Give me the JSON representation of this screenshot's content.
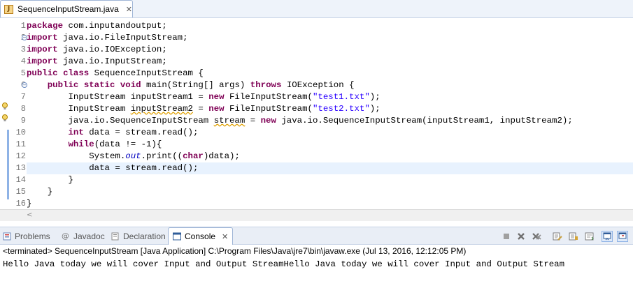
{
  "editor": {
    "tab_title": "SequenceInputStream.java",
    "tab_close": "✕",
    "current_line": 13
  },
  "code_lines": [
    [
      {
        "t": "kw",
        "v": "package"
      },
      {
        "t": "",
        "v": " com.inputandoutput;"
      }
    ],
    [
      {
        "t": "kw",
        "v": "import"
      },
      {
        "t": "",
        "v": " java.io.FileInputStream;"
      }
    ],
    [
      {
        "t": "kw",
        "v": "import"
      },
      {
        "t": "",
        "v": " java.io.IOException;"
      }
    ],
    [
      {
        "t": "kw",
        "v": "import"
      },
      {
        "t": "",
        "v": " java.io.InputStream;"
      }
    ],
    [
      {
        "t": "kw",
        "v": "public"
      },
      {
        "t": "",
        "v": " "
      },
      {
        "t": "kw",
        "v": "class"
      },
      {
        "t": "",
        "v": " SequenceInputStream {"
      }
    ],
    [
      {
        "t": "",
        "v": "    "
      },
      {
        "t": "kw",
        "v": "public"
      },
      {
        "t": "",
        "v": " "
      },
      {
        "t": "kw",
        "v": "static"
      },
      {
        "t": "",
        "v": " "
      },
      {
        "t": "kw",
        "v": "void"
      },
      {
        "t": "",
        "v": " main(String[] args) "
      },
      {
        "t": "kw",
        "v": "throws"
      },
      {
        "t": "",
        "v": " IOException {"
      }
    ],
    [
      {
        "t": "",
        "v": "        InputStream inputStream1 = "
      },
      {
        "t": "kw",
        "v": "new"
      },
      {
        "t": "",
        "v": " FileInputStream("
      },
      {
        "t": "str",
        "v": "\"test1.txt\""
      },
      {
        "t": "",
        "v": ");"
      }
    ],
    [
      {
        "t": "",
        "v": "        InputStream "
      },
      {
        "t": "warn",
        "v": "inputStream2"
      },
      {
        "t": "",
        "v": " = "
      },
      {
        "t": "kw",
        "v": "new"
      },
      {
        "t": "",
        "v": " FileInputStream("
      },
      {
        "t": "str",
        "v": "\"test2.txt\""
      },
      {
        "t": "",
        "v": ");"
      }
    ],
    [
      {
        "t": "",
        "v": "        java.io.SequenceInputStream "
      },
      {
        "t": "warn",
        "v": "stream"
      },
      {
        "t": "",
        "v": " = "
      },
      {
        "t": "kw",
        "v": "new"
      },
      {
        "t": "",
        "v": " java.io.SequenceInputStream(inputStream1, inputStream2);"
      }
    ],
    [
      {
        "t": "",
        "v": "        "
      },
      {
        "t": "kw",
        "v": "int"
      },
      {
        "t": "",
        "v": " data = stream.read();"
      }
    ],
    [
      {
        "t": "",
        "v": "        "
      },
      {
        "t": "kw",
        "v": "while"
      },
      {
        "t": "",
        "v": "(data != -1){"
      }
    ],
    [
      {
        "t": "",
        "v": "            System."
      },
      {
        "t": "fld",
        "v": "out"
      },
      {
        "t": "",
        "v": ".print(("
      },
      {
        "t": "kw",
        "v": "char"
      },
      {
        "t": "",
        "v": ")data);"
      }
    ],
    [
      {
        "t": "",
        "v": "            data = stream.read();"
      }
    ],
    [
      {
        "t": "",
        "v": "        }"
      }
    ],
    [
      {
        "t": "",
        "v": "    }"
      }
    ],
    [
      {
        "t": "",
        "v": "}"
      }
    ]
  ],
  "line_numbers": [
    "1",
    "2",
    "3",
    "4",
    "5",
    "6",
    "7",
    "8",
    "9",
    "10",
    "11",
    "12",
    "13",
    "14",
    "15",
    "16"
  ],
  "fold_markers": {
    "2": "−",
    "6": "−"
  },
  "warning_lines": [
    8,
    9
  ],
  "scroll_left": "<",
  "views": {
    "problems": "Problems",
    "javadoc": "Javadoc",
    "declaration": "Declaration",
    "console": "Console",
    "console_close": "✕"
  },
  "console": {
    "status": "<terminated> SequenceInputStream [Java Application] C:\\Program Files\\Java\\jre7\\bin\\javaw.exe (Jul 13, 2016, 12:12:05 PM)",
    "output": "Hello Java today we will cover Input and Output StreamHello Java today we will cover Input and Output Stream"
  },
  "colors": {
    "keyword": "#7f0055",
    "string": "#2a00ff",
    "field": "#0000c0",
    "current_line_bg": "#e8f2fe"
  },
  "icons": {
    "tab": "java-file-icon",
    "problems": "problems-icon",
    "javadoc": "at-icon",
    "declaration": "declaration-icon",
    "console": "console-icon",
    "warning": "warning-lightbulb-icon"
  }
}
